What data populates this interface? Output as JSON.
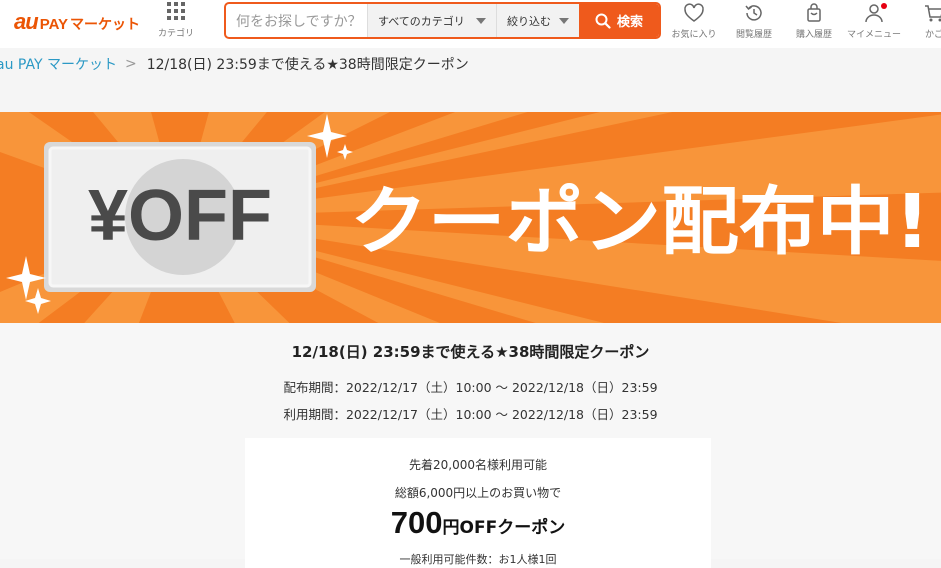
{
  "header": {
    "logo_au": "au",
    "logo_pay": "PAY",
    "logo_market": "マーケット",
    "category_label": "カテゴリ",
    "search_placeholder": "何をお探しですか？",
    "category_select": "すべてのカテゴリ",
    "filter_select": "絞り込む",
    "search_button": "検索",
    "nav": [
      {
        "label": "お気に入り",
        "icon": "heart-icon"
      },
      {
        "label": "閲覧履歴",
        "icon": "history-icon"
      },
      {
        "label": "購入履歴",
        "icon": "purchase-bag-icon"
      },
      {
        "label": "マイメニュー",
        "icon": "user-icon"
      },
      {
        "label": "かご",
        "icon": "cart-icon"
      }
    ]
  },
  "breadcrumb": {
    "home": "au PAY マーケット",
    "separator": ">",
    "current": "12/18(日) 23:59まで使える★38時間限定クーポン"
  },
  "banner": {
    "badge_text": "¥OFF",
    "headline": "クーポン配布中!",
    "colors": {
      "orange": "#f47d23",
      "ray": "#f8953a"
    }
  },
  "coupon": {
    "title": "12/18(日) 23:59まで使える★38時間限定クーポン",
    "distribution_period": "配布期間：2022/12/17（土）10:00 ～ 2022/12/18（日）23:59",
    "usage_period": "利用期間：2022/12/17（土）10:00 ～ 2022/12/18（日）23:59",
    "first_come": "先着20,000名様利用可能",
    "condition": "総額6,000円以上のお買い物で",
    "amount": "700",
    "amount_unit": "円OFFクーポン",
    "partial_line": "一般利用可能件数：お1人様1回"
  },
  "colors": {
    "accent": "#ef5a1c",
    "link": "#2b99c5",
    "badge": "#e60012"
  }
}
